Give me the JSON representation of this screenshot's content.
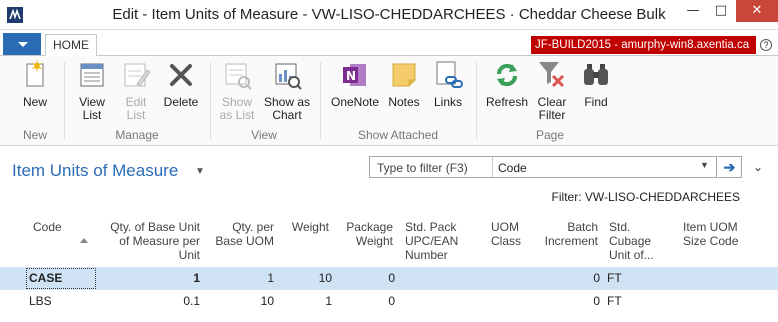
{
  "window": {
    "title": "Edit - Item Units of Measure - VW-LISO-CHEDDARCHEES · Cheddar Cheese Bulk",
    "minimize": "—",
    "maximize": "□",
    "close": "✕"
  },
  "tabs": {
    "home": "HOME",
    "build_badge": "JF-BUILD2015 - amurphy-win8.axentia.ca",
    "help": "?"
  },
  "ribbon": {
    "new": "New",
    "view_list": [
      "View",
      "List"
    ],
    "edit_list": [
      "Edit",
      "List"
    ],
    "delete": "Delete",
    "show_as_list": [
      "Show",
      "as List"
    ],
    "show_as_chart": [
      "Show as",
      "Chart"
    ],
    "onenote": "OneNote",
    "notes": "Notes",
    "links": "Links",
    "refresh": "Refresh",
    "clear_filter": [
      "Clear",
      "Filter"
    ],
    "find": "Find",
    "groups": {
      "new": "New",
      "manage": "Manage",
      "view": "View",
      "show_attached": "Show Attached",
      "page": "Page"
    }
  },
  "page": {
    "title": "Item Units of Measure",
    "filter_placeholder": "Type to filter (F3)",
    "filter_field": "Code",
    "filter_text": "Filter: VW-LISO-CHEDDARCHEES"
  },
  "table": {
    "headers": {
      "code": [
        "Code"
      ],
      "qty_base": [
        "Qty. of Base Unit",
        "of Measure per",
        "Unit"
      ],
      "qty_per_base": [
        "Qty. per",
        "Base UOM"
      ],
      "weight": [
        "Weight"
      ],
      "package_weight": [
        "Package",
        "Weight"
      ],
      "std_pack": [
        "Std. Pack",
        "UPC/EAN",
        "Number"
      ],
      "uom_class": [
        "UOM",
        "Class"
      ],
      "batch_increment": [
        "Batch",
        "Increment"
      ],
      "std_cubage": [
        "Std.",
        "Cubage",
        "Unit of..."
      ],
      "item_uom_size": [
        "Item UOM",
        "Size Code"
      ]
    },
    "rows": [
      {
        "code": "CASE",
        "qty_base": "1",
        "qty_per_base": "1",
        "weight": "10",
        "package_weight": "0",
        "std_pack": "",
        "uom_class": "",
        "batch_increment": "0",
        "std_cubage": "FT",
        "item_uom_size": ""
      },
      {
        "code": "LBS",
        "qty_base": "0.1",
        "qty_per_base": "10",
        "weight": "1",
        "package_weight": "0",
        "std_pack": "",
        "uom_class": "",
        "batch_increment": "0",
        "std_cubage": "FT",
        "item_uom_size": ""
      }
    ]
  }
}
